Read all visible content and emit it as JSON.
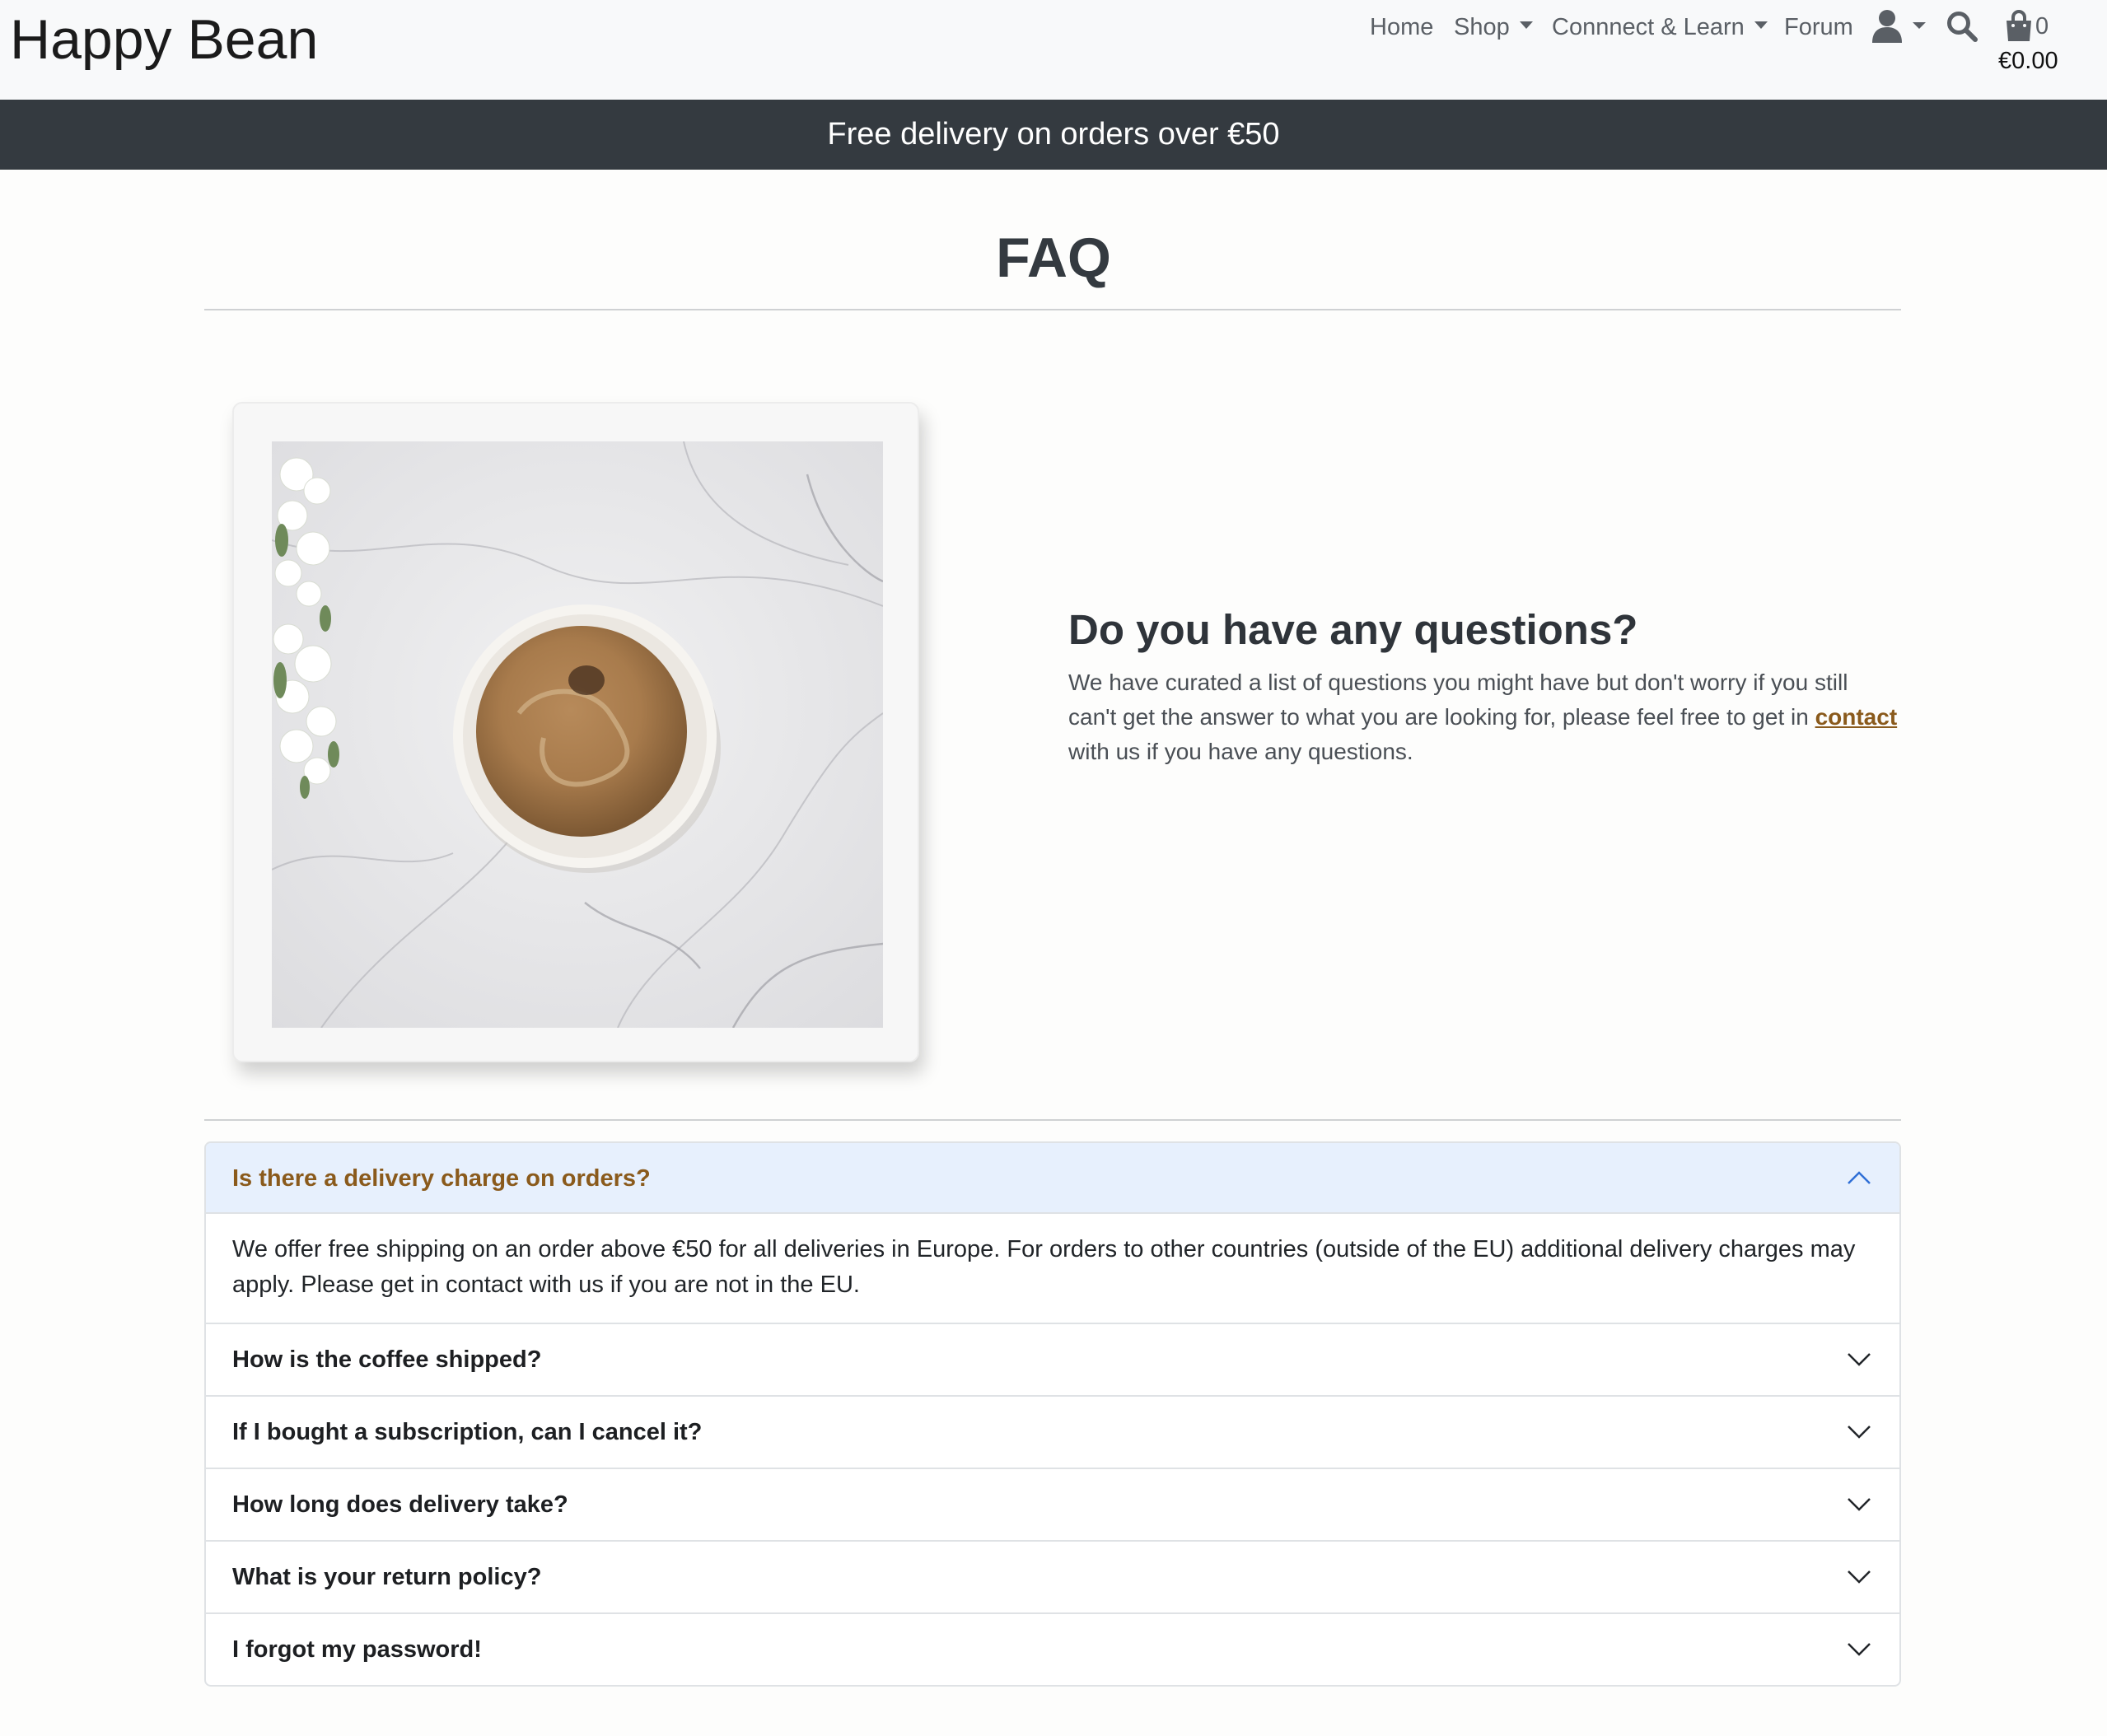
{
  "navbar": {
    "brand": "Happy Bean",
    "links": {
      "home": "Home",
      "shop": "Shop",
      "connect": "Connnect & Learn",
      "forum": "Forum"
    },
    "cart": {
      "count": "0",
      "total": "€0.00"
    },
    "icons": [
      "user-icon",
      "search-icon",
      "shopping-bag-icon"
    ]
  },
  "banner": {
    "text": "Free delivery on orders over €50"
  },
  "page": {
    "title": "FAQ",
    "intro": {
      "heading": "Do you have any questions?",
      "text_before": "We have curated a list of questions you might have but don't worry if you still can't get the answer to what you are looking for, please feel free to get in ",
      "link": "contact",
      "text_after": " with us if you have any questions."
    }
  },
  "faq": [
    {
      "question": "Is there a delivery charge on orders?",
      "answer": "We offer free shipping on an order above €50 for all deliveries in Europe. For orders to other countries (outside of the EU) additional delivery charges may apply. Please get in contact with us if you are not in the EU.",
      "expanded": true
    },
    {
      "question": "How is the coffee shipped?",
      "expanded": false
    },
    {
      "question": "If I bought a subscription, can I cancel it?",
      "expanded": false
    },
    {
      "question": "How long does delivery take?",
      "expanded": false
    },
    {
      "question": "What is your return policy?",
      "expanded": false
    },
    {
      "question": "I forgot my password!",
      "expanded": false
    }
  ],
  "colors": {
    "banner_bg": "#343a40",
    "accent": "#8a5a1c",
    "open_header_bg": "#e7f0fd"
  }
}
